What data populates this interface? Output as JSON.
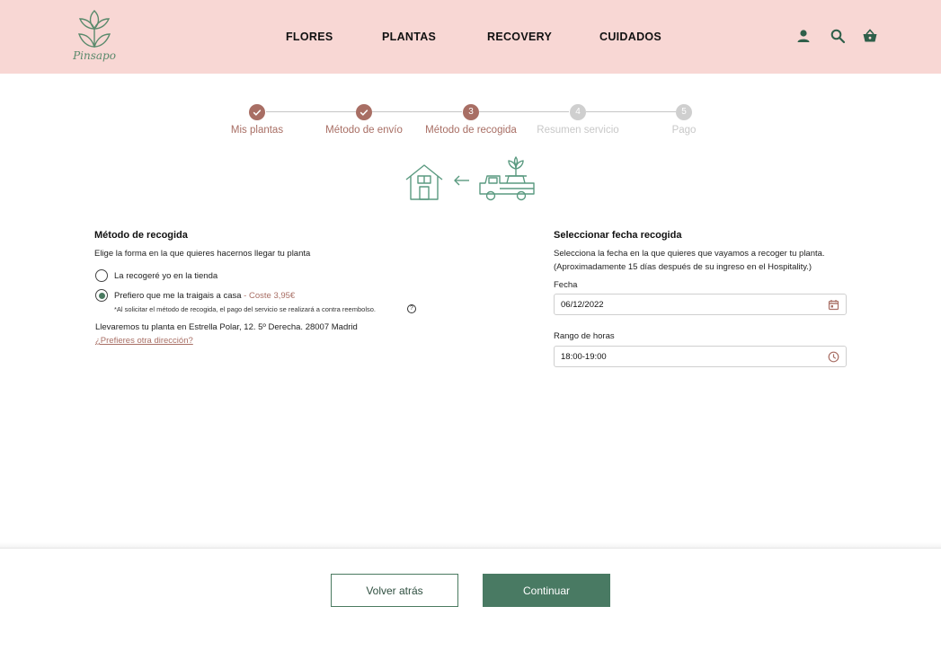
{
  "brand": {
    "name": "Pinsapo"
  },
  "nav": {
    "items": [
      {
        "label": "FLORES"
      },
      {
        "label": "PLANTAS"
      },
      {
        "label": "RECOVERY"
      },
      {
        "label": "CUIDADOS"
      }
    ]
  },
  "header_icons": [
    "user-icon",
    "search-icon",
    "basket-icon"
  ],
  "stepper": {
    "steps": [
      {
        "number": "1",
        "label": "Mis plantas",
        "status": "done"
      },
      {
        "number": "2",
        "label": "Método de envío",
        "status": "done"
      },
      {
        "number": "3",
        "label": "Método de recogida",
        "status": "current"
      },
      {
        "number": "4",
        "label": "Resumen servicio",
        "status": "pending"
      },
      {
        "number": "5",
        "label": "Pago",
        "status": "pending"
      }
    ]
  },
  "pickup": {
    "title": "Método de recogida",
    "subtitle": "Elige la forma en la que quieres hacernos llegar  tu planta",
    "option1": "La recogeré yo en la tienda",
    "option2": "Prefiero que me la traigais a casa",
    "option2_sep": " - ",
    "option2_cost": "Coste 3,95€",
    "note": "*Al solicitar el método de recogida, el pago del servicio se realizará a contra reembolso.",
    "help_glyph": "?",
    "address": "Llevaremos tu planta en Estrella Polar, 12. 5º Derecha. 28007 Madrid",
    "change_link": "¿Prefieres otra dirección?"
  },
  "schedule": {
    "title": "Seleccionar fecha recogida",
    "desc1": "Selecciona la fecha en la que quieres que vayamos a recoger tu planta.",
    "desc2": "(Aproximadamente 15 días después de su ingreso en el Hospitality.)",
    "date_label": "Fecha",
    "date_value": "06/12/2022",
    "hours_label": "Rango de horas",
    "hours_value": "18:00-19:00"
  },
  "footer": {
    "back": "Volver atrás",
    "continue": "Continuar"
  },
  "colors": {
    "header_bg": "#f8d7d4",
    "accent_rose": "#a86e64",
    "accent_green": "#497a63",
    "pending_grey": "#cfcfcf"
  }
}
